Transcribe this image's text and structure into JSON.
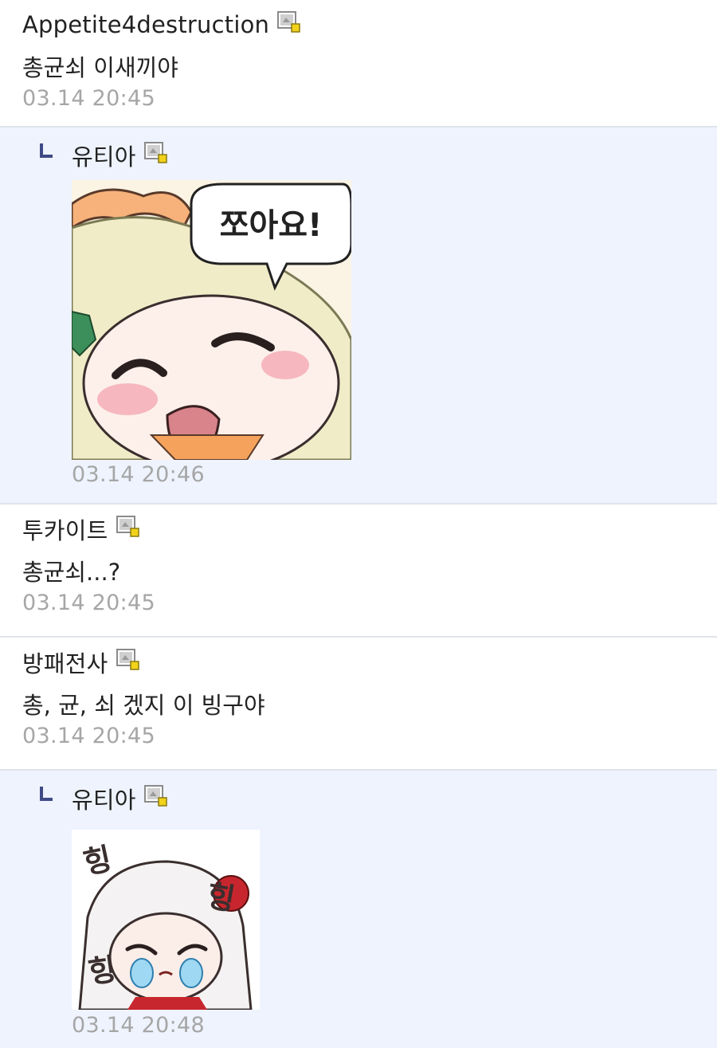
{
  "comments": [
    {
      "author": "Appetite4destruction",
      "level_icon": "level-badge-icon",
      "text": "총균쇠 이새끼야",
      "time": "03.14 20:45",
      "reply": false
    },
    {
      "author": "유티아",
      "level_icon": "level-badge-icon",
      "sticker_text": "쪼아요!",
      "time": "03.14 20:46",
      "reply": true
    },
    {
      "author": "투카이트",
      "level_icon": "level-badge-icon",
      "text": "총균쇠...?",
      "time": "03.14 20:45",
      "reply": false
    },
    {
      "author": "방패전사",
      "level_icon": "level-badge-icon",
      "text": "총, 균, 쇠 겠지 이 빙구야",
      "time": "03.14 20:45",
      "reply": false
    },
    {
      "author": "유티아",
      "level_icon": "level-badge-icon",
      "sticker_text": "힝",
      "time": "03.14 20:48",
      "reply": true
    }
  ],
  "colors": {
    "reply_background": "#eef3fe",
    "divider": "#dfe3ea",
    "timestamp": "#a6a6a6",
    "reply_arrow": "#3f4a86",
    "badge_yellow": "#f2d21a"
  }
}
